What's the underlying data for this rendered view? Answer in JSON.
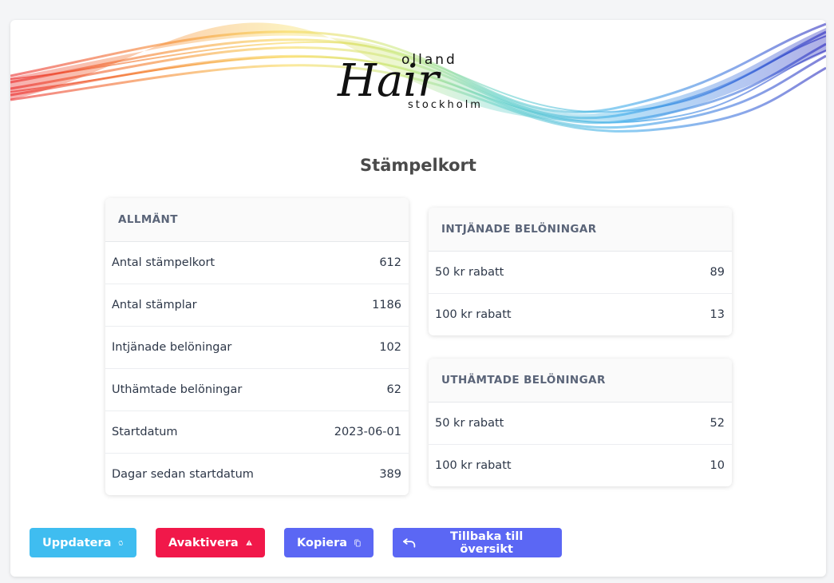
{
  "logo": {
    "text_top": "olland",
    "text_main": "Hair",
    "text_bottom": "stockholm"
  },
  "page_title": "Stämpelkort",
  "general": {
    "header": "ALLMÄNT",
    "rows": [
      {
        "label": "Antal stämpelkort",
        "value": "612"
      },
      {
        "label": "Antal stämplar",
        "value": "1186"
      },
      {
        "label": "Intjänade belöningar",
        "value": "102"
      },
      {
        "label": "Uthämtade belöningar",
        "value": "62"
      },
      {
        "label": "Startdatum",
        "value": "2023-06-01"
      },
      {
        "label": "Dagar sedan startdatum",
        "value": "389"
      }
    ]
  },
  "earned": {
    "header": "INTJÄNADE BELÖNINGAR",
    "rows": [
      {
        "label": "50 kr rabatt",
        "value": "89"
      },
      {
        "label": "100 kr rabatt",
        "value": "13"
      }
    ]
  },
  "redeemed": {
    "header": "UTHÄMTADE BELÖNINGAR",
    "rows": [
      {
        "label": "50 kr rabatt",
        "value": "52"
      },
      {
        "label": "100 kr rabatt",
        "value": "10"
      }
    ]
  },
  "buttons": {
    "update": {
      "label": "Uppdatera",
      "icon": "refresh-icon"
    },
    "deactivate": {
      "label": "Avaktivera",
      "icon": "warning-icon"
    },
    "copy": {
      "label": "Kopiera",
      "icon": "copy-icon"
    },
    "back": {
      "label": "Tillbaka till översikt",
      "icon": "undo-icon"
    }
  },
  "colors": {
    "update": "#3fbdf0",
    "deactivate": "#f1184a",
    "primary": "#5b67f4"
  }
}
